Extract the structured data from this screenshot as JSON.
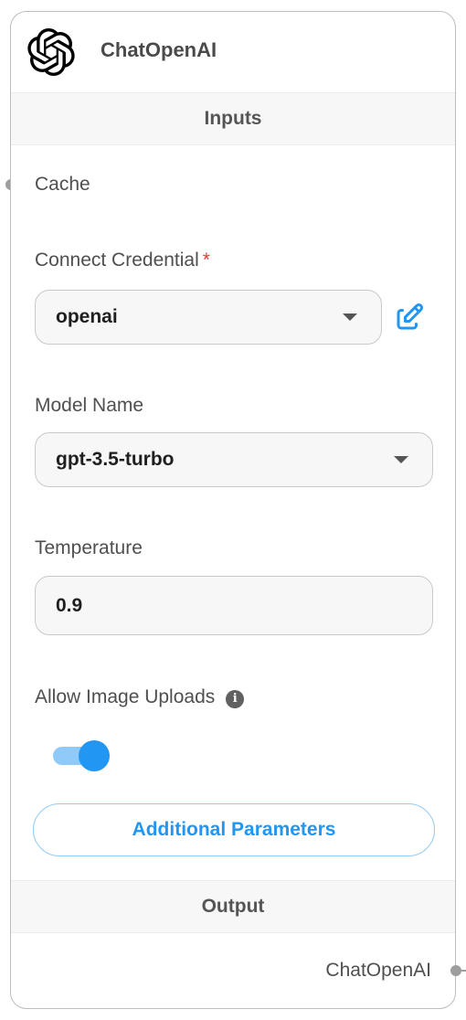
{
  "node": {
    "title": "ChatOpenAI",
    "logo_icon": "openai-logo-icon"
  },
  "inputs_section": {
    "title": "Inputs"
  },
  "cache": {
    "label": "Cache"
  },
  "credential": {
    "label": "Connect Credential",
    "required_mark": "*",
    "value": "openai",
    "edit_icon": "edit-icon"
  },
  "model_name": {
    "label": "Model Name",
    "value": "gpt-3.5-turbo"
  },
  "temperature": {
    "label": "Temperature",
    "value": "0.9"
  },
  "image_uploads": {
    "label": "Allow Image Uploads",
    "info_icon": "info-icon",
    "enabled": true
  },
  "additional_parameters": {
    "label": "Additional Parameters"
  },
  "output_section": {
    "title": "Output"
  },
  "output": {
    "label": "ChatOpenAI"
  },
  "colors": {
    "accent": "#2196f3",
    "accent_light": "#90caf9",
    "required": "#e53935",
    "handle": "#9e9e9e"
  }
}
